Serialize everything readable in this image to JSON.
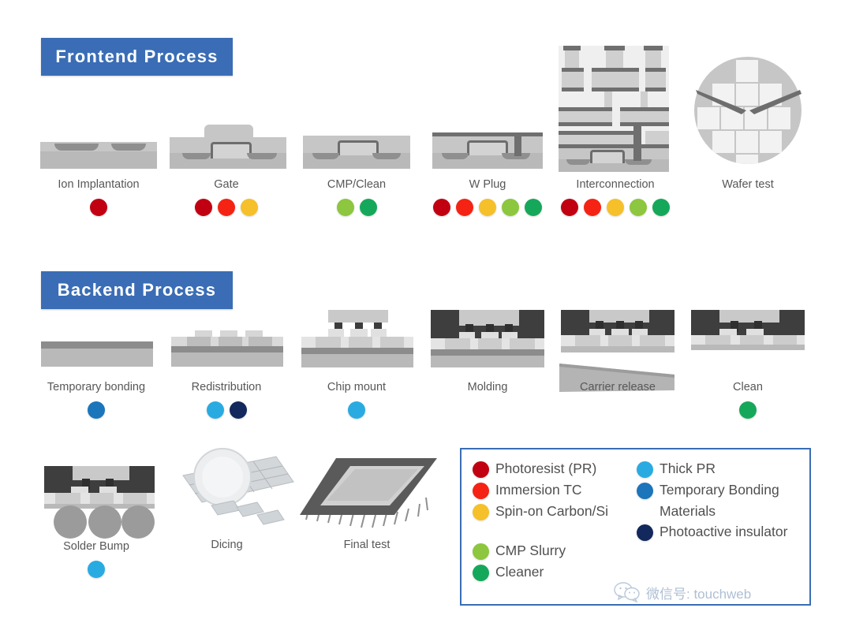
{
  "sections": {
    "frontend": {
      "title": "Frontend Process"
    },
    "backend": {
      "title": "Backend Process"
    }
  },
  "palette": {
    "banner_blue": "#3a6db5",
    "photoresist_dark_red": "#c10012",
    "immersion_red": "#f52314",
    "spin_on_yellow": "#f5c02a",
    "cmp_light_green": "#8dc63f",
    "cleaner_green": "#16a85a",
    "thick_pr_cyan": "#29abe2",
    "temp_bonding_blue": "#1b75bb",
    "photoactive_navy": "#13285c"
  },
  "frontend_steps": [
    {
      "label": "Ion Implantation",
      "dots": [
        "#c10012"
      ]
    },
    {
      "label": "Gate",
      "dots": [
        "#c10012",
        "#f52314",
        "#f5c02a"
      ]
    },
    {
      "label": "CMP/Clean",
      "dots": [
        "#8dc63f",
        "#16a85a"
      ]
    },
    {
      "label": "W Plug",
      "dots": [
        "#c10012",
        "#f52314",
        "#f5c02a",
        "#8dc63f",
        "#16a85a"
      ]
    },
    {
      "label": "Interconnection",
      "dots": [
        "#c10012",
        "#f52314",
        "#f5c02a",
        "#8dc63f",
        "#16a85a"
      ]
    },
    {
      "label": "Wafer test",
      "dots": []
    }
  ],
  "backend_steps_row1": [
    {
      "label": "Temporary bonding",
      "dots": [
        "#1b75bb"
      ]
    },
    {
      "label": "Redistribution",
      "dots": [
        "#29abe2",
        "#13285c"
      ]
    },
    {
      "label": "Chip mount",
      "dots": [
        "#29abe2"
      ]
    },
    {
      "label": "Molding",
      "dots": []
    },
    {
      "label": "Carrier release",
      "dots": []
    },
    {
      "label": "Clean",
      "dots": [
        "#16a85a"
      ]
    }
  ],
  "backend_steps_row2": [
    {
      "label": "Solder Bump",
      "dots": [
        "#29abe2"
      ]
    },
    {
      "label": "Dicing",
      "dots": []
    },
    {
      "label": "Final test",
      "dots": []
    }
  ],
  "legend": {
    "left_items": [
      {
        "color": "#c10012",
        "label": "Photoresist (PR)"
      },
      {
        "color": "#f52314",
        "label": "Immersion TC"
      },
      {
        "color": "#f5c02a",
        "label": "Spin-on Carbon/Si"
      },
      {
        "color": "#8dc63f",
        "label": "CMP Slurry"
      },
      {
        "color": "#16a85a",
        "label": "Cleaner"
      }
    ],
    "right_items": [
      {
        "color": "#29abe2",
        "label": "Thick PR"
      },
      {
        "color": "#1b75bb",
        "label": "Temporary Bonding",
        "label2": "Materials"
      },
      {
        "color": "#13285c",
        "label": "Photoactive insulator"
      }
    ]
  },
  "watermark": {
    "text": "微信号: touchweb"
  }
}
